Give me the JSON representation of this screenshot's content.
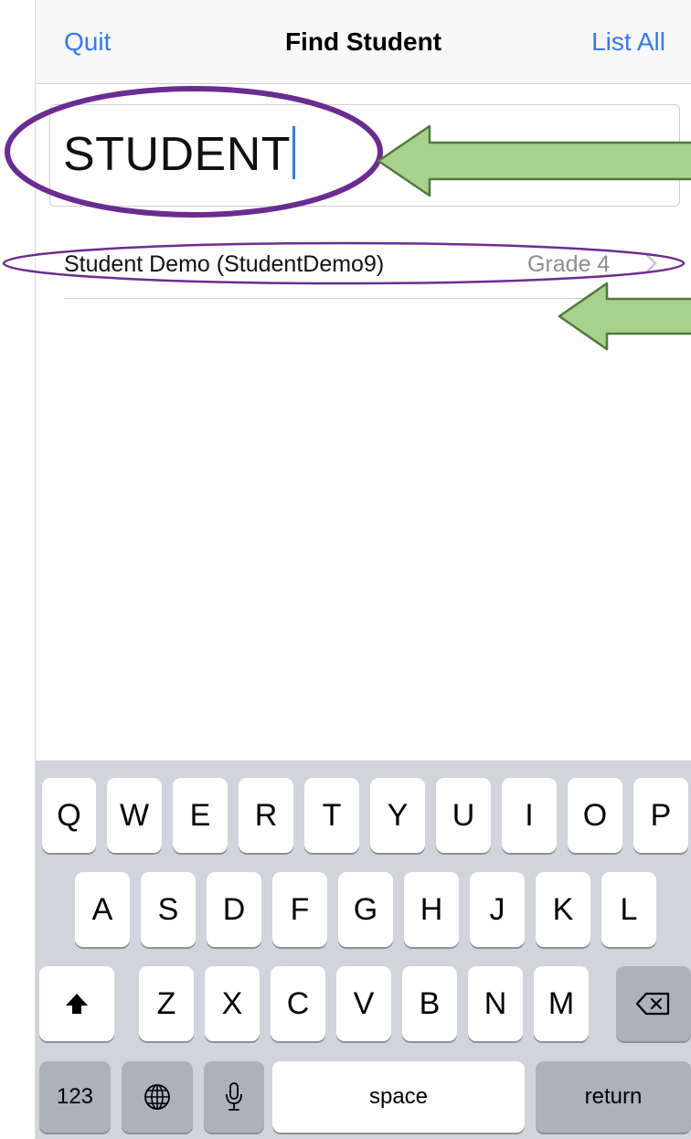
{
  "nav": {
    "left_label": "Quit",
    "title": "Find Student",
    "right_label": "List All"
  },
  "search": {
    "value": "STUDENT"
  },
  "results": [
    {
      "name": "Student Demo (StudentDemo9)",
      "grade": "Grade 4"
    }
  ],
  "keyboard": {
    "row1": [
      "Q",
      "W",
      "E",
      "R",
      "T",
      "Y",
      "U",
      "I",
      "O",
      "P"
    ],
    "row2": [
      "A",
      "S",
      "D",
      "F",
      "G",
      "H",
      "J",
      "K",
      "L"
    ],
    "row3": [
      "Z",
      "X",
      "C",
      "V",
      "B",
      "N",
      "M"
    ],
    "numbers_label": "123",
    "space_label": "space",
    "return_label": "return"
  },
  "colors": {
    "accent": "#3478f6",
    "annotation_ellipse": "#6b2c91",
    "annotation_arrow_fill": "#a9d18e",
    "annotation_arrow_stroke": "#4f7a3a"
  }
}
